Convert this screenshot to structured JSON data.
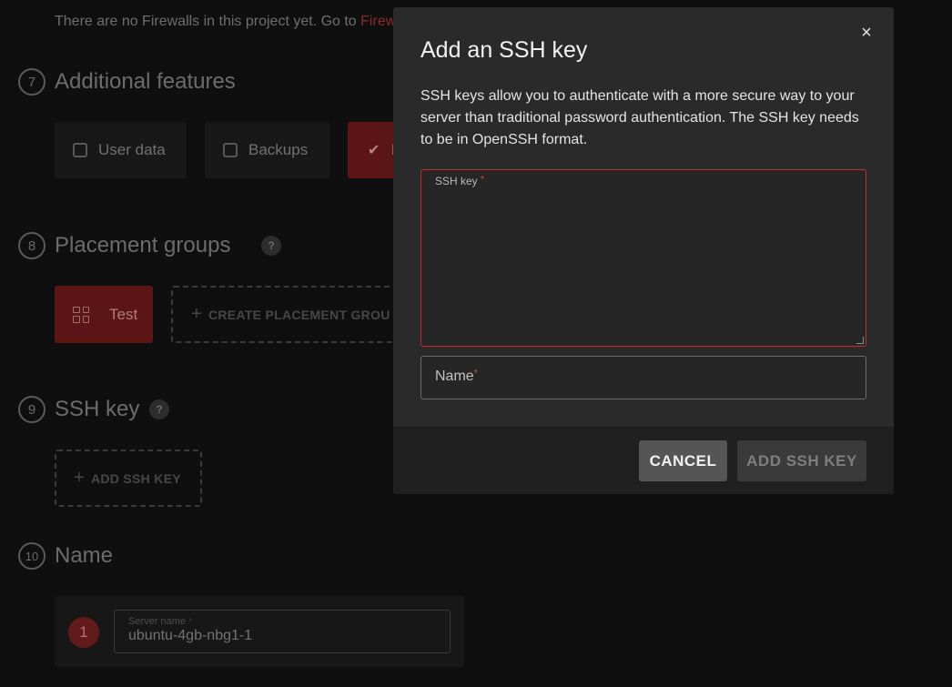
{
  "background": {
    "firewall_note": {
      "text": "There are no Firewalls in this project yet. Go to",
      "link": "Firewa"
    },
    "sections": {
      "additional_features": {
        "number": "7",
        "title": "Additional features",
        "options": [
          {
            "label": "User data",
            "checked": false
          },
          {
            "label": "Backups",
            "checked": false
          },
          {
            "label": "I",
            "checked": true
          }
        ]
      },
      "placement_groups": {
        "number": "8",
        "title": "Placement groups",
        "help": "?",
        "selected_group": "Test",
        "create_button": "CREATE PLACEMENT GROU"
      },
      "ssh_key": {
        "number": "9",
        "title": "SSH key",
        "help": "?",
        "add_button": "ADD SSH KEY"
      },
      "name": {
        "number": "10",
        "title": "Name",
        "server_index": "1",
        "server_label": "Server name",
        "server_label_required": "*",
        "server_value": "ubuntu-4gb-nbg1-1"
      }
    }
  },
  "modal": {
    "title": "Add an SSH key",
    "close_icon": "×",
    "description": "SSH keys allow you to authenticate with a more secure way to your server than traditional password authentication. The SSH key needs to be in OpenSSH format.",
    "ssh_key_field": {
      "label": "SSH key",
      "required": "*",
      "value": ""
    },
    "name_field": {
      "placeholder": "Name",
      "required": "*",
      "value": ""
    },
    "buttons": {
      "cancel": "CANCEL",
      "add": "ADD SSH KEY"
    },
    "colors": {
      "error_border": "#c52d2d",
      "required_star": "#e04848"
    }
  }
}
